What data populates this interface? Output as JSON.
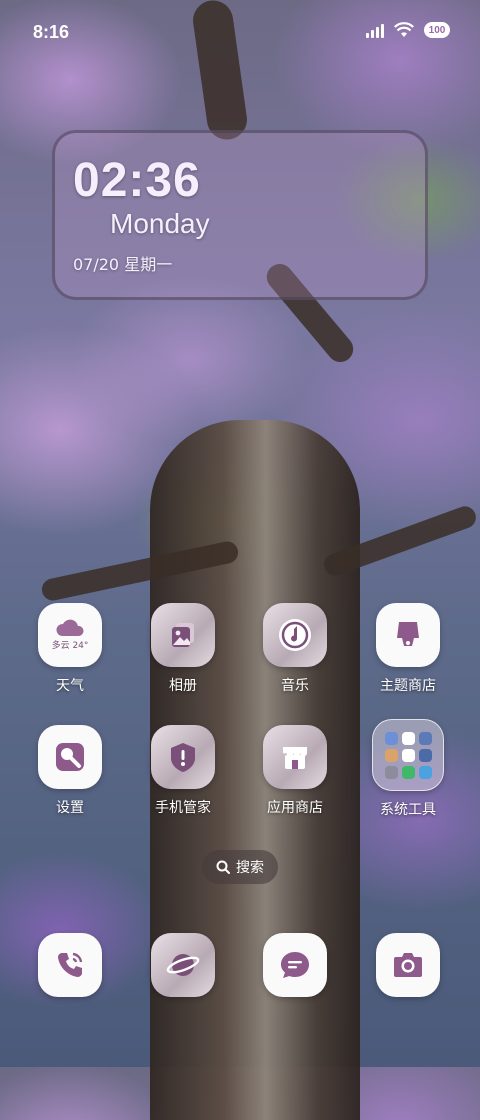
{
  "status_bar": {
    "time": "8:16",
    "battery_text": "100"
  },
  "clock_widget": {
    "time": "02:36",
    "weekday": "Monday",
    "date": "07/20  星期一"
  },
  "apps_row1": [
    {
      "label": "天气",
      "icon": "weather-icon",
      "icon_text": "多云 24°"
    },
    {
      "label": "相册",
      "icon": "gallery-icon"
    },
    {
      "label": "音乐",
      "icon": "music-icon"
    },
    {
      "label": "主题商店",
      "icon": "theme-store-icon"
    }
  ],
  "apps_row2": [
    {
      "label": "设置",
      "icon": "settings-icon"
    },
    {
      "label": "手机管家",
      "icon": "security-shield-icon"
    },
    {
      "label": "应用商店",
      "icon": "app-store-icon"
    },
    {
      "label": "系统工具",
      "icon": "folder-icon"
    }
  ],
  "search": {
    "label": "搜索"
  },
  "dock": [
    {
      "icon": "phone-icon"
    },
    {
      "icon": "browser-planet-icon"
    },
    {
      "icon": "messages-icon"
    },
    {
      "icon": "camera-icon"
    }
  ],
  "colors": {
    "accent": "#8e5a8c",
    "icon_bg": "#fafafa"
  }
}
